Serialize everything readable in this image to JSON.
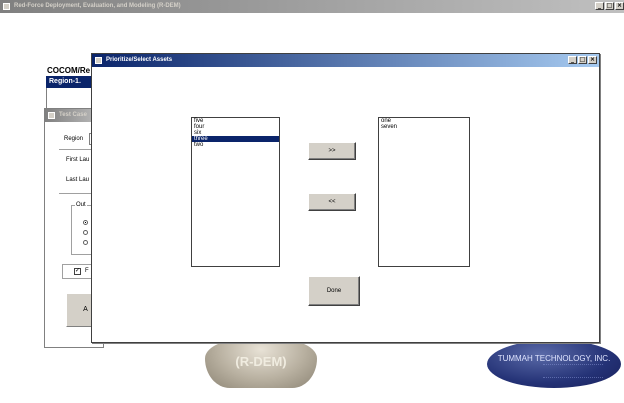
{
  "main_window": {
    "title": "Red-Force Deployment, Evaluation, and Modeling (R-DEM)",
    "controls": [
      "_",
      "□",
      "×"
    ]
  },
  "background": {
    "cocom_label": "COCOM/Re",
    "region_value": "Region-1.",
    "rdem_logo_text": "(R-DEM)",
    "tummah_logo_text": "TUMMAH TECHNOLOGY, INC."
  },
  "test_case_window": {
    "title": "Test Case",
    "region_label": "Region",
    "first_launch_label": "First Lau",
    "last_launch_label": "Last Lau",
    "group_label": "Out",
    "checkbox_label": "F",
    "checkbox_mark": "✓",
    "button_label": "A"
  },
  "dialog": {
    "title": "Prioritize/Select Assets",
    "controls": [
      "_",
      "□",
      "×"
    ],
    "available_list": [
      "five",
      "four",
      "six",
      "three",
      "two"
    ],
    "available_selected_index": 3,
    "selected_list": [
      "one",
      "seven"
    ],
    "add_button": ">>",
    "remove_button": "<<",
    "done_button": "Done"
  }
}
